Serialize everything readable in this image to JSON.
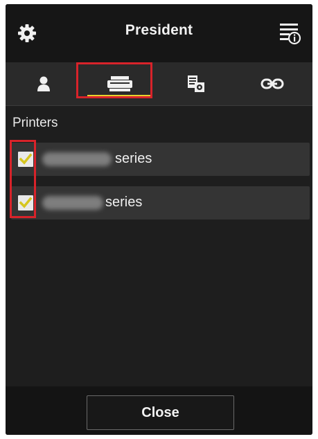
{
  "header": {
    "title": "President",
    "left_icon": "gear-icon",
    "right_icon": "menu-info-icon"
  },
  "tabs": [
    {
      "icon": "user-icon",
      "selected": false
    },
    {
      "icon": "printer-icon",
      "selected": true
    },
    {
      "icon": "document-settings-icon",
      "selected": false
    },
    {
      "icon": "link-icon",
      "selected": false
    }
  ],
  "printers": {
    "section_label": "Printers",
    "items": [
      {
        "name_suffix": "series",
        "checked": true
      },
      {
        "name_suffix": "series",
        "checked": true
      }
    ]
  },
  "footer": {
    "close_label": "Close"
  },
  "colors": {
    "accent_yellow": "#e6d32e",
    "highlight_red": "#d8232a",
    "background_dark": "#1f1f1f"
  }
}
